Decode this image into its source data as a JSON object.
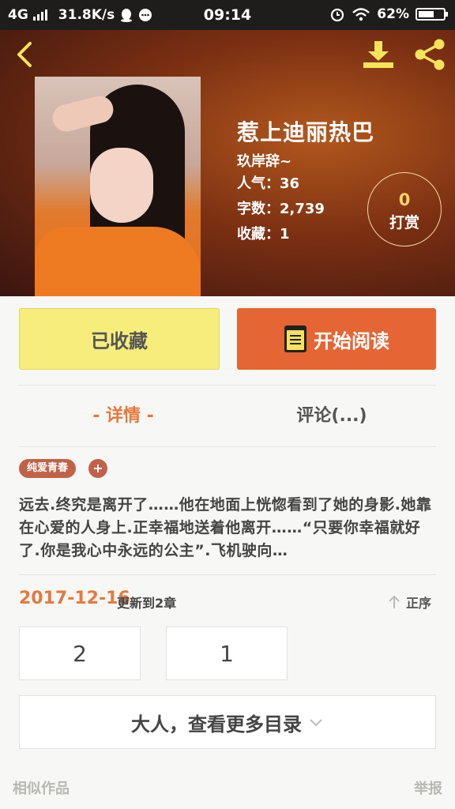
{
  "status_bar": {
    "network": "4G",
    "speed": "31.8K/s",
    "time": "09:14",
    "battery": "62%",
    "battery_level": 0.62
  },
  "book": {
    "title": "惹上迪丽热巴",
    "author": "玖岸辞~",
    "stats": [
      {
        "label": "人气：",
        "value": "36"
      },
      {
        "label": "字数：",
        "value": "2,739"
      },
      {
        "label": "收藏：",
        "value": "1"
      }
    ],
    "reward_count": "0",
    "reward_label": "打赏"
  },
  "actions": {
    "favorite_label": "已收藏",
    "read_label": "开始阅读"
  },
  "tabs": {
    "detail": "- 详情 -",
    "comment": "评论(...)"
  },
  "tags": [
    "纯爱青春"
  ],
  "tag_add": "+",
  "description": "远去.终究是离开了……他在地面上恍惚看到了她的身影.她靠在心爱的人身上.正幸福地送着他离开……“只要你幸福就好了.你是我心中永远的公主”.飞机驶向…",
  "chapters": {
    "update_date": "2017-12-16",
    "update_text": "更新到2章",
    "sort_label": "正序",
    "items": [
      "2",
      "1"
    ],
    "more_label": "大人，查看更多目录"
  },
  "footer": {
    "similar": "相似作品",
    "report": "举报"
  },
  "colors": {
    "accent": "#e5793e",
    "read_button": "#e56534",
    "favorite_button": "#f7ed7c",
    "icon_yellow": "#f5e35b"
  }
}
